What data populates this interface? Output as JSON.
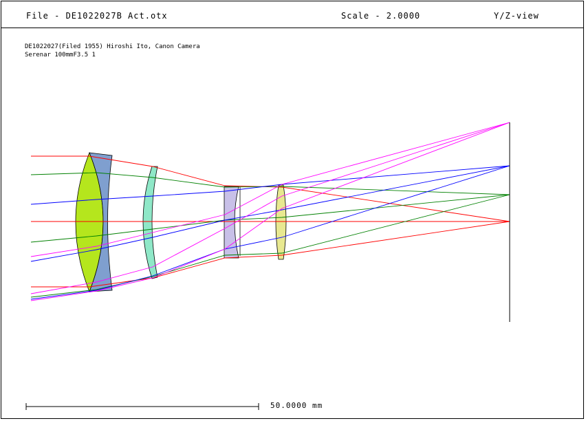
{
  "header": {
    "file_label": "File - DE1022027B Act.otx",
    "scale_label": "Scale - 2.0000",
    "view_label": "Y/Z-view"
  },
  "description": {
    "line1": "DE1022027(Filed 1955) Hiroshi Ito, Canon Camera",
    "line2": "Serenar 100mmF3.5 1"
  },
  "scale_bar": {
    "label": "50.0000 mm"
  },
  "colors": {
    "ray_axial": "#ff0000",
    "ray_field_1": "#008000",
    "ray_field_2": "#0000ff",
    "ray_field_3": "#ff00ff",
    "element_1": "#b5e61d",
    "element_2": "#7f9fcf",
    "element_3": "#8fe8c8",
    "element_4": "#c8c0e8",
    "element_5": "#e8e890"
  }
}
